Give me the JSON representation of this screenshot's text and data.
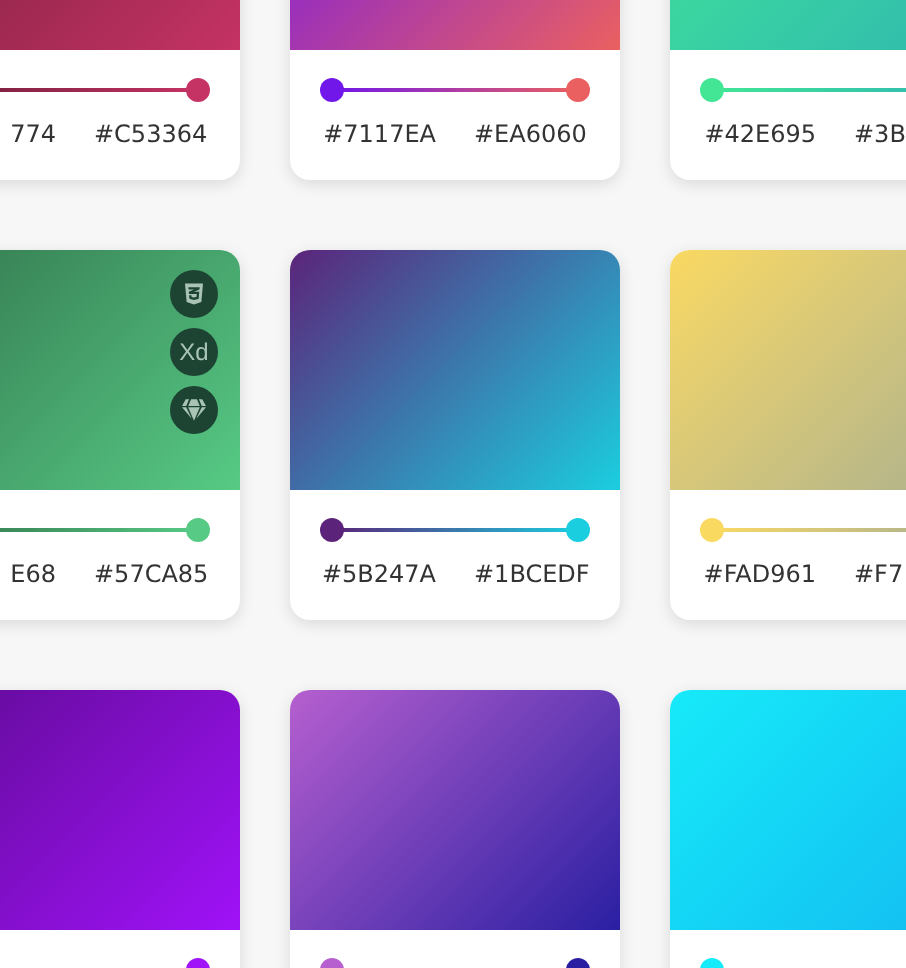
{
  "cards": [
    {
      "start": {
        "code": "774"
      },
      "end": {
        "code": "#C53364"
      }
    },
    {
      "start": {
        "code": "#7117EA"
      },
      "end": {
        "code": "#EA6060"
      }
    },
    {
      "start": {
        "code": "#42E695"
      },
      "end": {
        "code": "#3B"
      }
    },
    {
      "start": {
        "code": "E68"
      },
      "end": {
        "code": "#57CA85"
      },
      "actions": [
        {
          "kind": "css"
        },
        {
          "kind": "text",
          "label": "Xd"
        },
        {
          "kind": "gem"
        }
      ]
    },
    {
      "start": {
        "code": "#5B247A"
      },
      "end": {
        "code": "#1BCEDF"
      }
    },
    {
      "start": {
        "code": "#FAD961"
      },
      "end": {
        "code": "#F7"
      }
    },
    {
      "end": {
        "color": "#A012F8"
      }
    },
    {
      "start": {
        "color": "#B65FCF"
      },
      "end": {
        "color": "#2A1FA2"
      }
    },
    {
      "start": {
        "color": "#17EAF9"
      }
    }
  ]
}
